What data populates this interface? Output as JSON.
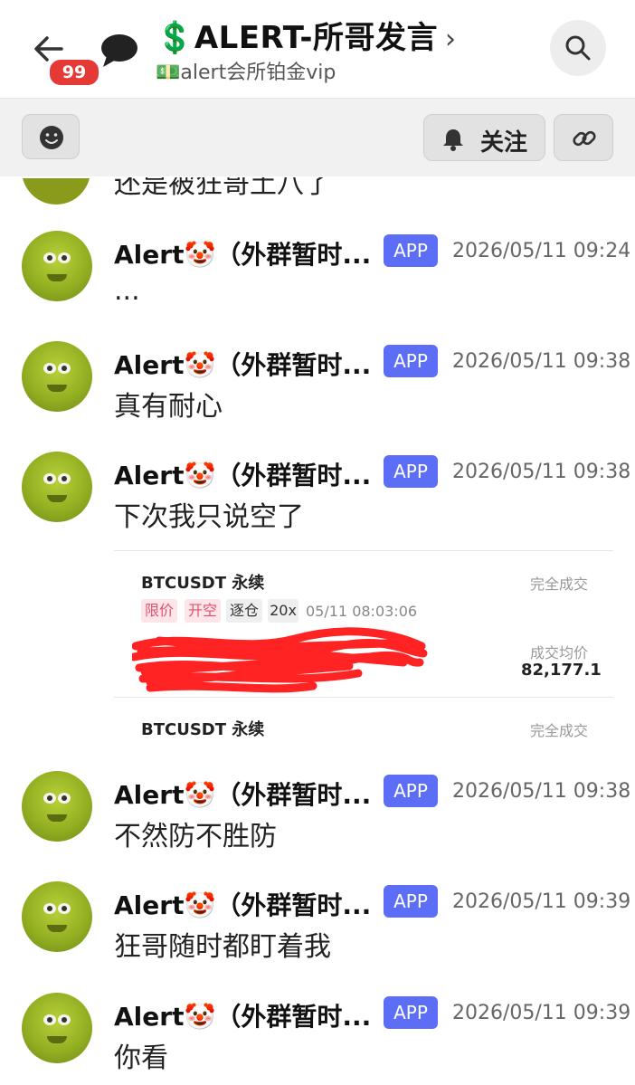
{
  "header": {
    "badge_count": "99",
    "title": "💲ALERT-所哥发言",
    "subtitle": "💵alert会所铂金vip"
  },
  "toolbar": {
    "follow_label": "关注"
  },
  "previous_message": {
    "text": "还是被狂哥土八了"
  },
  "messages": [
    {
      "name": "Alert🤡（外群暂时...",
      "badge": "APP",
      "time": "2026/05/11 09:24",
      "text": "..."
    },
    {
      "name": "Alert🤡（外群暂时...",
      "badge": "APP",
      "time": "2026/05/11 09:38",
      "text": "真有耐心"
    },
    {
      "name": "Alert🤡（外群暂时...",
      "badge": "APP",
      "time": "2026/05/11 09:38",
      "text": "下次我只说空了"
    },
    {
      "name": "Alert🤡（外群暂时...",
      "badge": "APP",
      "time": "2026/05/11 09:38",
      "text": "不然防不胜防"
    },
    {
      "name": "Alert🤡（外群暂时...",
      "badge": "APP",
      "time": "2026/05/11 09:39",
      "text": "狂哥随时都盯着我"
    },
    {
      "name": "Alert🤡（外群暂时...",
      "badge": "APP",
      "time": "2026/05/11 09:39",
      "text": "你看"
    }
  ],
  "embedded_screenshot": {
    "pair": "BTCUSDT 永续",
    "status": "完全成交",
    "tags": [
      "限价",
      "开空",
      "逐仓",
      "20x"
    ],
    "datetime": "05/11 08:03:06",
    "avg_label": "成交均价",
    "avg_value": "82,177.1",
    "pair_2": "BTCUSDT 永续",
    "status_2": "完全成交"
  }
}
